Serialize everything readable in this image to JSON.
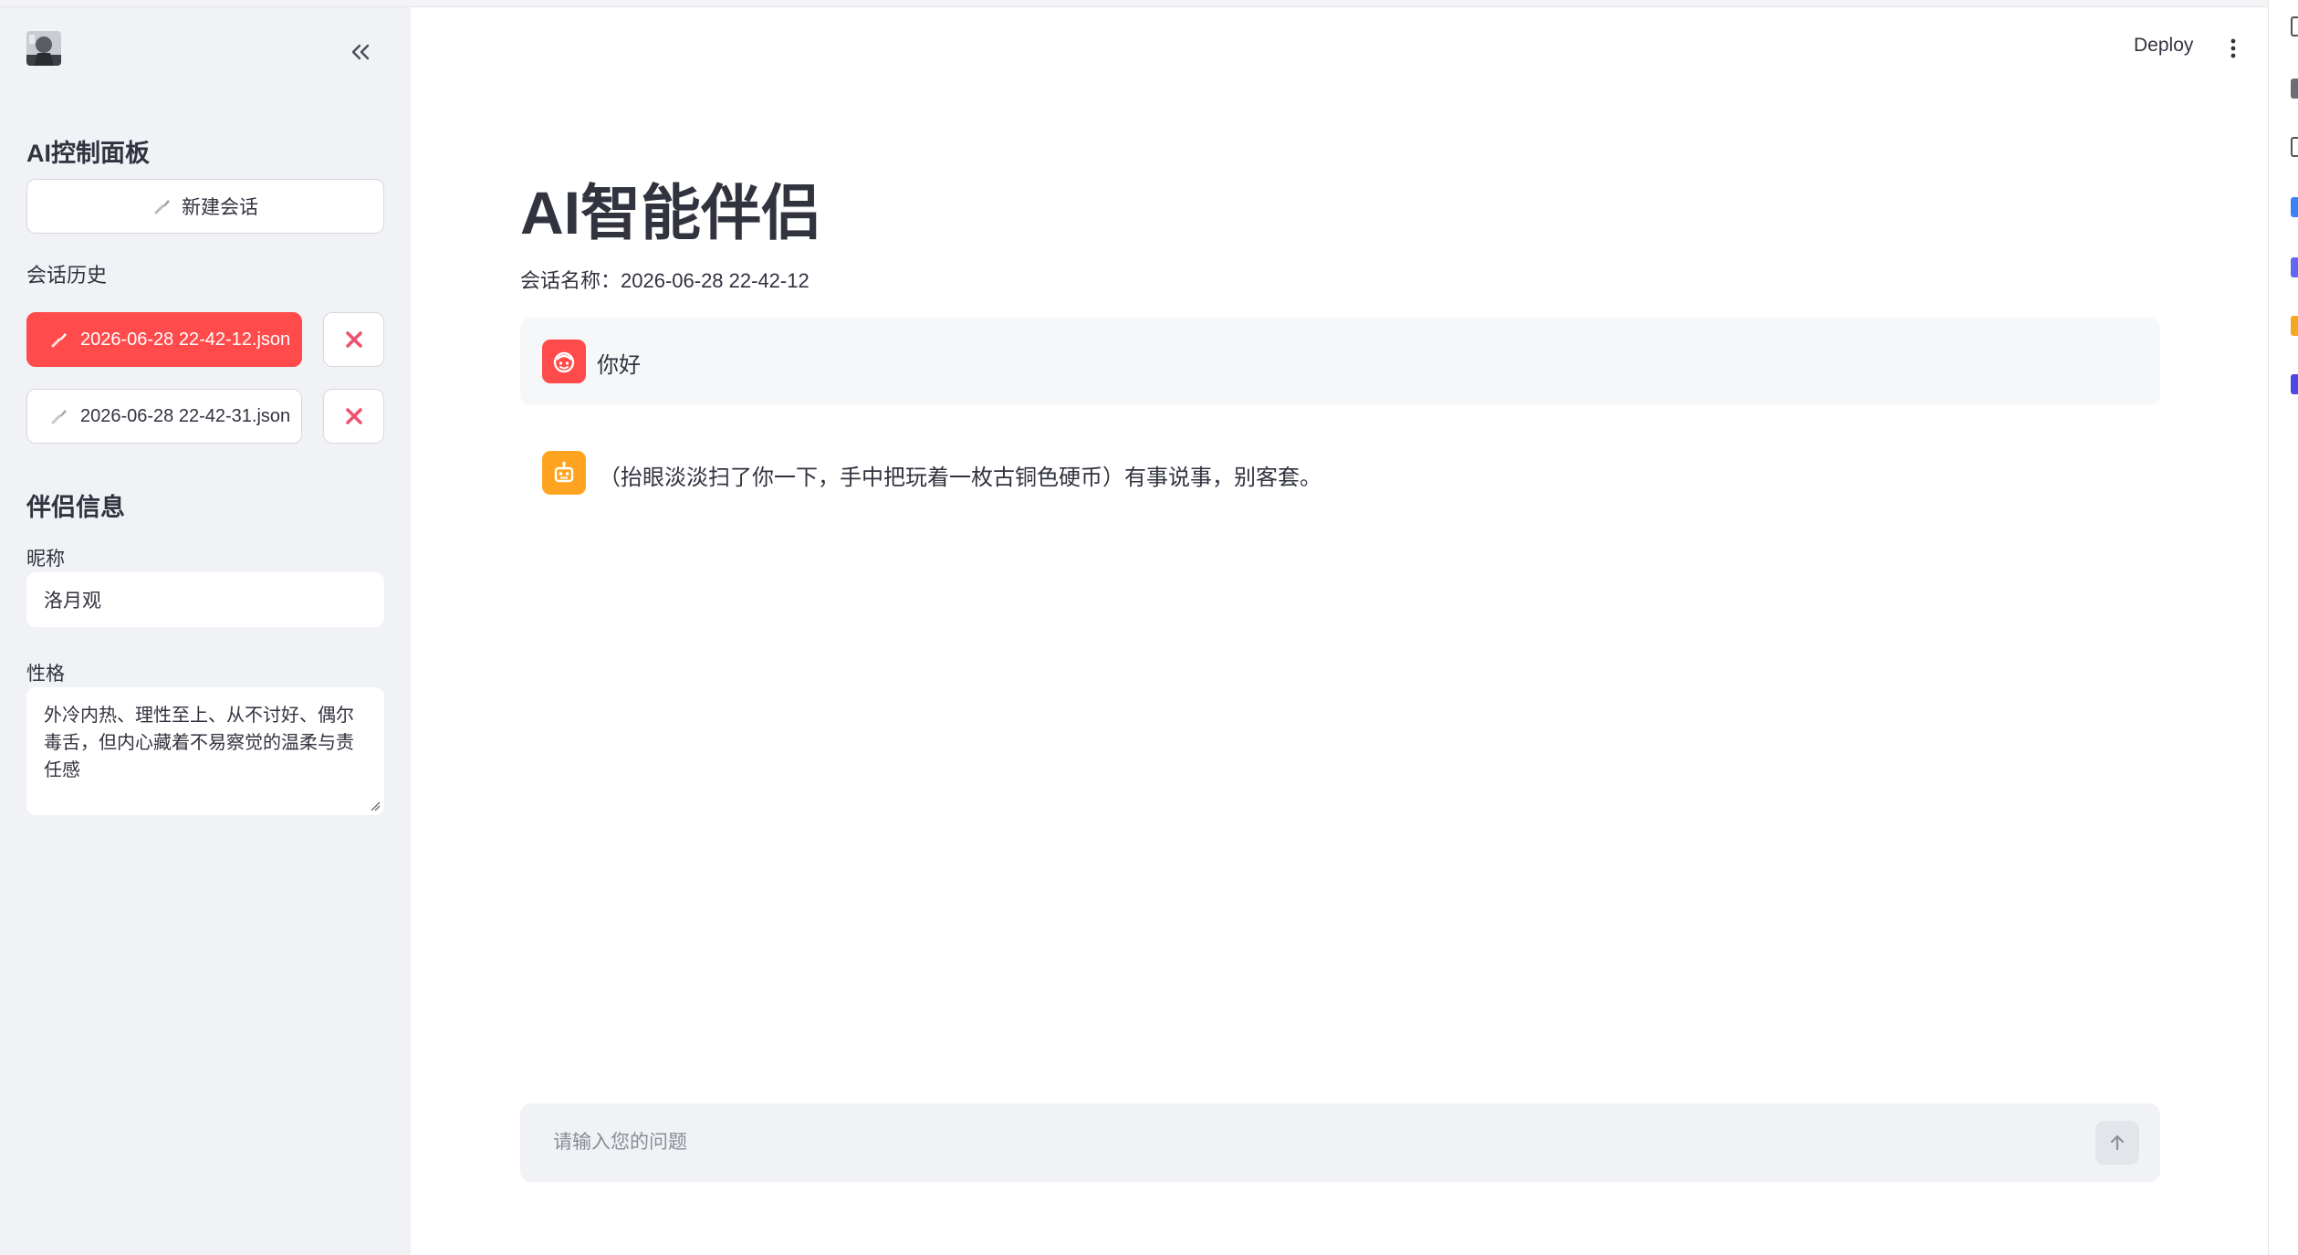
{
  "sidebar": {
    "panel_title": "AI控制面板",
    "new_chat_label": "新建会话",
    "history_title": "会话历史",
    "history": [
      {
        "label": "2026-06-28 22-42-12.json",
        "active": true
      },
      {
        "label": "2026-06-28 22-42-31.json",
        "active": false
      }
    ],
    "companion_title": "伴侣信息",
    "nickname_label": "昵称",
    "nickname_value": "洛月观",
    "personality_label": "性格",
    "personality_value": "外冷内热、理性至上、从不讨好、偶尔毒舌，但内心藏着不易察觉的温柔与责任感"
  },
  "header": {
    "deploy_label": "Deploy"
  },
  "main": {
    "title": "AI智能伴侣",
    "session_label": "会话名称：2026-06-28 22-42-12",
    "messages": [
      {
        "role": "user",
        "text": "你好"
      },
      {
        "role": "assistant",
        "text": "（抬眼淡淡扫了你一下，手中把玩着一枚古铜色硬币）有事说事，别客套。"
      }
    ],
    "input_placeholder": "请输入您的问题"
  },
  "colors": {
    "accent": "#ff4b4b",
    "sidebar_bg": "#f0f2f6",
    "user_avatar": "#ff4b4b",
    "assistant_avatar": "#ffa421",
    "delete_icon": "#f0506e"
  },
  "icons": {
    "collapse": "double-chevron-left-icon",
    "new_chat": "brush-icon",
    "history_item": "brush-icon",
    "delete": "close-x-icon",
    "user_avatar": "user-face-icon",
    "assistant_avatar": "robot-icon",
    "menu": "kebab-menu-icon",
    "send": "arrow-up-icon"
  }
}
